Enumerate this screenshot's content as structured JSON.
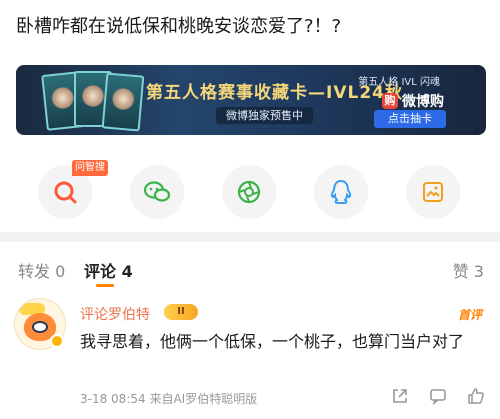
{
  "post": {
    "title": "卧槽咋都在说低保和桃晚安谈恋爱了?！?"
  },
  "banner": {
    "title": "第五人格赛事收藏卡—IVL24秋",
    "subtitle": "微博独家预售中",
    "brand_text": "第五人格 IVL 闪魂",
    "shop_label": "微博购",
    "cta_label": "点击抽卡"
  },
  "share": {
    "ai_tag": "问智搜",
    "icons": [
      "ai-search-icon",
      "wechat-icon",
      "moments-icon",
      "qq-icon",
      "save-image-icon"
    ]
  },
  "tabs": {
    "repost": "转发 0",
    "comment": "评论 4",
    "like": "赞 3"
  },
  "comment": {
    "author": "评论罗伯特",
    "level": "II",
    "badge": "首评",
    "text": "我寻思着，他俩一个低保，一个桃子，也算门当户对了",
    "meta": "3-18 08:54  来自AI罗伯特聪明版"
  },
  "colors": {
    "accent": "#ff8200",
    "author": "#eb7350",
    "ai_tag": "#ff6a3d"
  }
}
